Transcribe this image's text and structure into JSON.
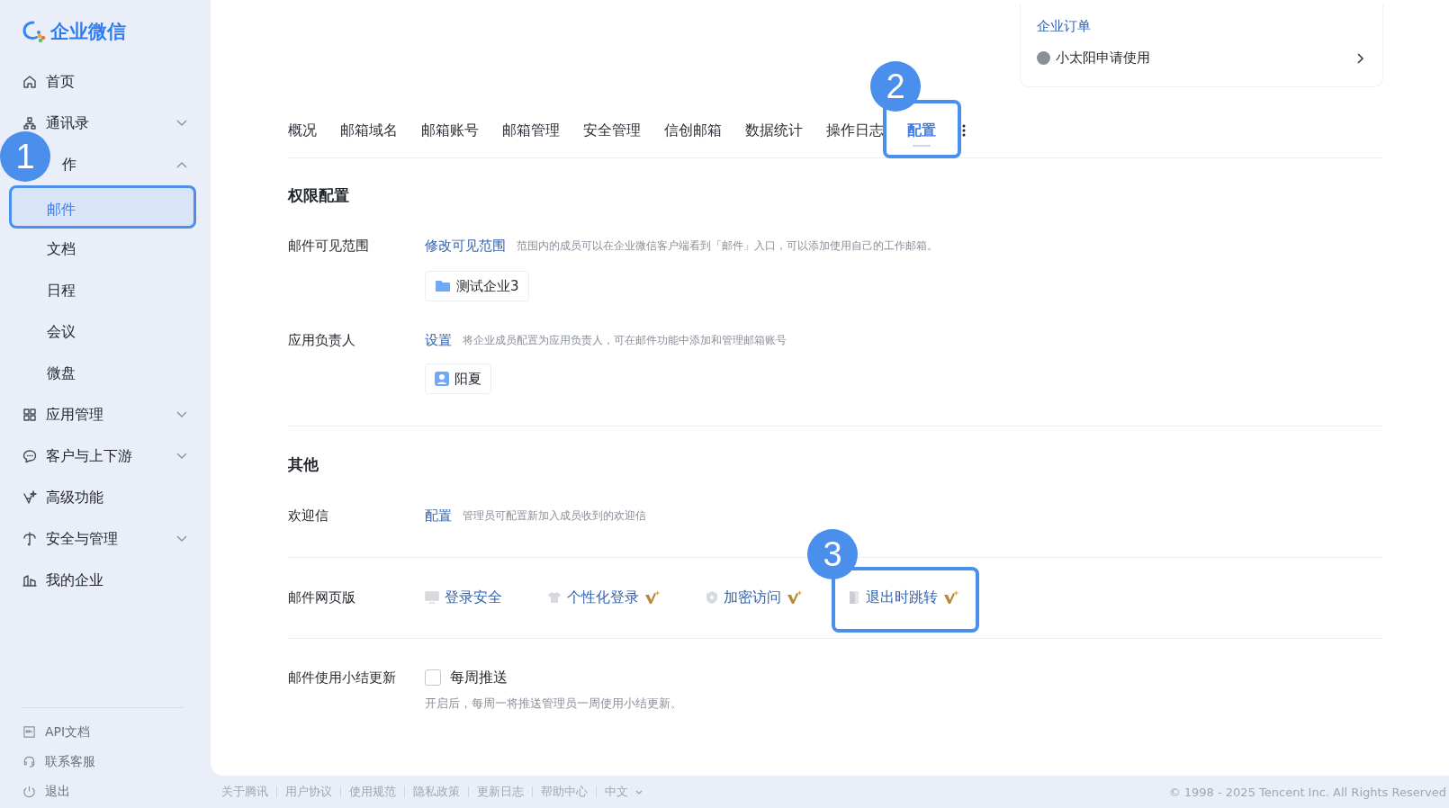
{
  "sidebar": {
    "logo": "企业微信",
    "items": [
      {
        "label": "首页"
      },
      {
        "label": "通讯录",
        "expanded": false
      },
      {
        "label": "作",
        "expanded": true,
        "children": [
          {
            "label": "邮件",
            "selected": true,
            "annotation": "1"
          },
          {
            "label": "文档",
            "selected": false
          },
          {
            "label": "日程",
            "selected": false
          },
          {
            "label": "会议",
            "selected": false
          },
          {
            "label": "微盘",
            "selected": false
          }
        ]
      },
      {
        "label": "应用管理",
        "expanded": false
      },
      {
        "label": "客户与上下游",
        "expanded": false
      },
      {
        "label": "高级功能"
      },
      {
        "label": "安全与管理",
        "expanded": false
      },
      {
        "label": "我的企业"
      }
    ],
    "bottom_links": [
      "API文档",
      "联系客服",
      "退出"
    ]
  },
  "order_card": {
    "title": "企业订单",
    "request": "小太阳申请使用"
  },
  "tabs": [
    {
      "label": "概况",
      "selected": false
    },
    {
      "label": "邮箱域名",
      "selected": false
    },
    {
      "label": "邮箱账号",
      "selected": false
    },
    {
      "label": "邮箱管理",
      "selected": false
    },
    {
      "label": "安全管理",
      "selected": false
    },
    {
      "label": "信创邮箱",
      "selected": false
    },
    {
      "label": "数据统计",
      "selected": false
    },
    {
      "label": "操作日志",
      "selected": false
    },
    {
      "label": "配置",
      "selected": true,
      "annotation": "2"
    }
  ],
  "sections": [
    {
      "title": "权限配置",
      "rows": [
        {
          "kind": "link",
          "label": "邮件可见范围",
          "link": "修改可见范围",
          "hint": "范围内的成员可以在企业微信客户端看到「邮件」入口，可以添加使用自己的工作邮箱。",
          "chip": {
            "kind": "folder",
            "text": "测试企业3"
          }
        },
        {
          "kind": "link",
          "label": "应用负责人",
          "link": "设置",
          "hint": "将企业成员配置为应用负责人，可在邮件功能中添加和管理邮箱账号",
          "chip": {
            "kind": "person",
            "text": "阳夏"
          }
        }
      ]
    },
    {
      "title": "其他",
      "rows": [
        {
          "kind": "link",
          "label": "欢迎信",
          "link": "配置",
          "hint": "管理员可配置新加入成员收到的欢迎信"
        },
        {
          "kind": "options",
          "label": "邮件网页版",
          "options": [
            {
              "label": "登录安全",
              "premium": false
            },
            {
              "label": "个性化登录",
              "premium": true
            },
            {
              "label": "加密访问",
              "premium": true
            },
            {
              "label": "退出时跳转",
              "premium": true,
              "annotation": "3"
            }
          ]
        },
        {
          "kind": "checkbox",
          "label": "邮件使用小结更新",
          "checkbox": {
            "label": "每周推送",
            "checked": false
          },
          "hint": "开启后，每周一将推送管理员一周使用小结更新。"
        }
      ]
    }
  ],
  "footer": {
    "links": [
      "关于腾讯",
      "用户协议",
      "使用规范",
      "隐私政策",
      "更新日志",
      "帮助中心"
    ],
    "language": "中文",
    "copyright": "© 1998 - 2025 Tencent Inc. All Rights Reserved"
  }
}
